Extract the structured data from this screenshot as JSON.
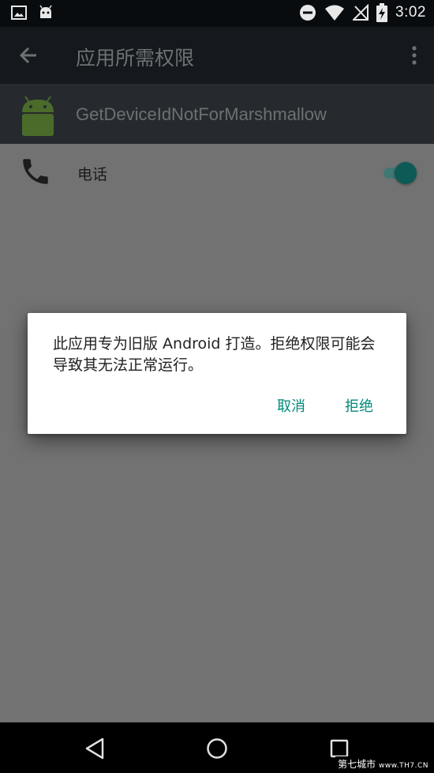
{
  "status_bar": {
    "time": "3:02",
    "icons": [
      "image-icon",
      "android-notify-icon",
      "do-not-disturb-icon",
      "wifi-icon",
      "no-signal-icon",
      "battery-charging-icon"
    ]
  },
  "app_bar": {
    "title": "应用所需权限",
    "back_icon": "arrow-back-icon",
    "menu_icon": "more-vert-icon"
  },
  "app_header": {
    "app_name": "GetDeviceIdNotForMarshmallow",
    "icon": "android-robot-icon"
  },
  "permissions": [
    {
      "label": "电话",
      "icon": "phone-icon",
      "enabled": true
    }
  ],
  "dialog": {
    "message": "此应用专为旧版 Android 打造。拒绝权限可能会导致其无法正常运行。",
    "cancel_label": "取消",
    "deny_label": "拒绝"
  },
  "nav_bar": {
    "icons": [
      "nav-back-icon",
      "nav-home-icon",
      "nav-recents-icon"
    ]
  },
  "watermark": {
    "brand": "第七城市",
    "site": "www.TH7.CN"
  },
  "colors": {
    "accent": "#00897b",
    "switch_thumb": "#0d5a56"
  }
}
